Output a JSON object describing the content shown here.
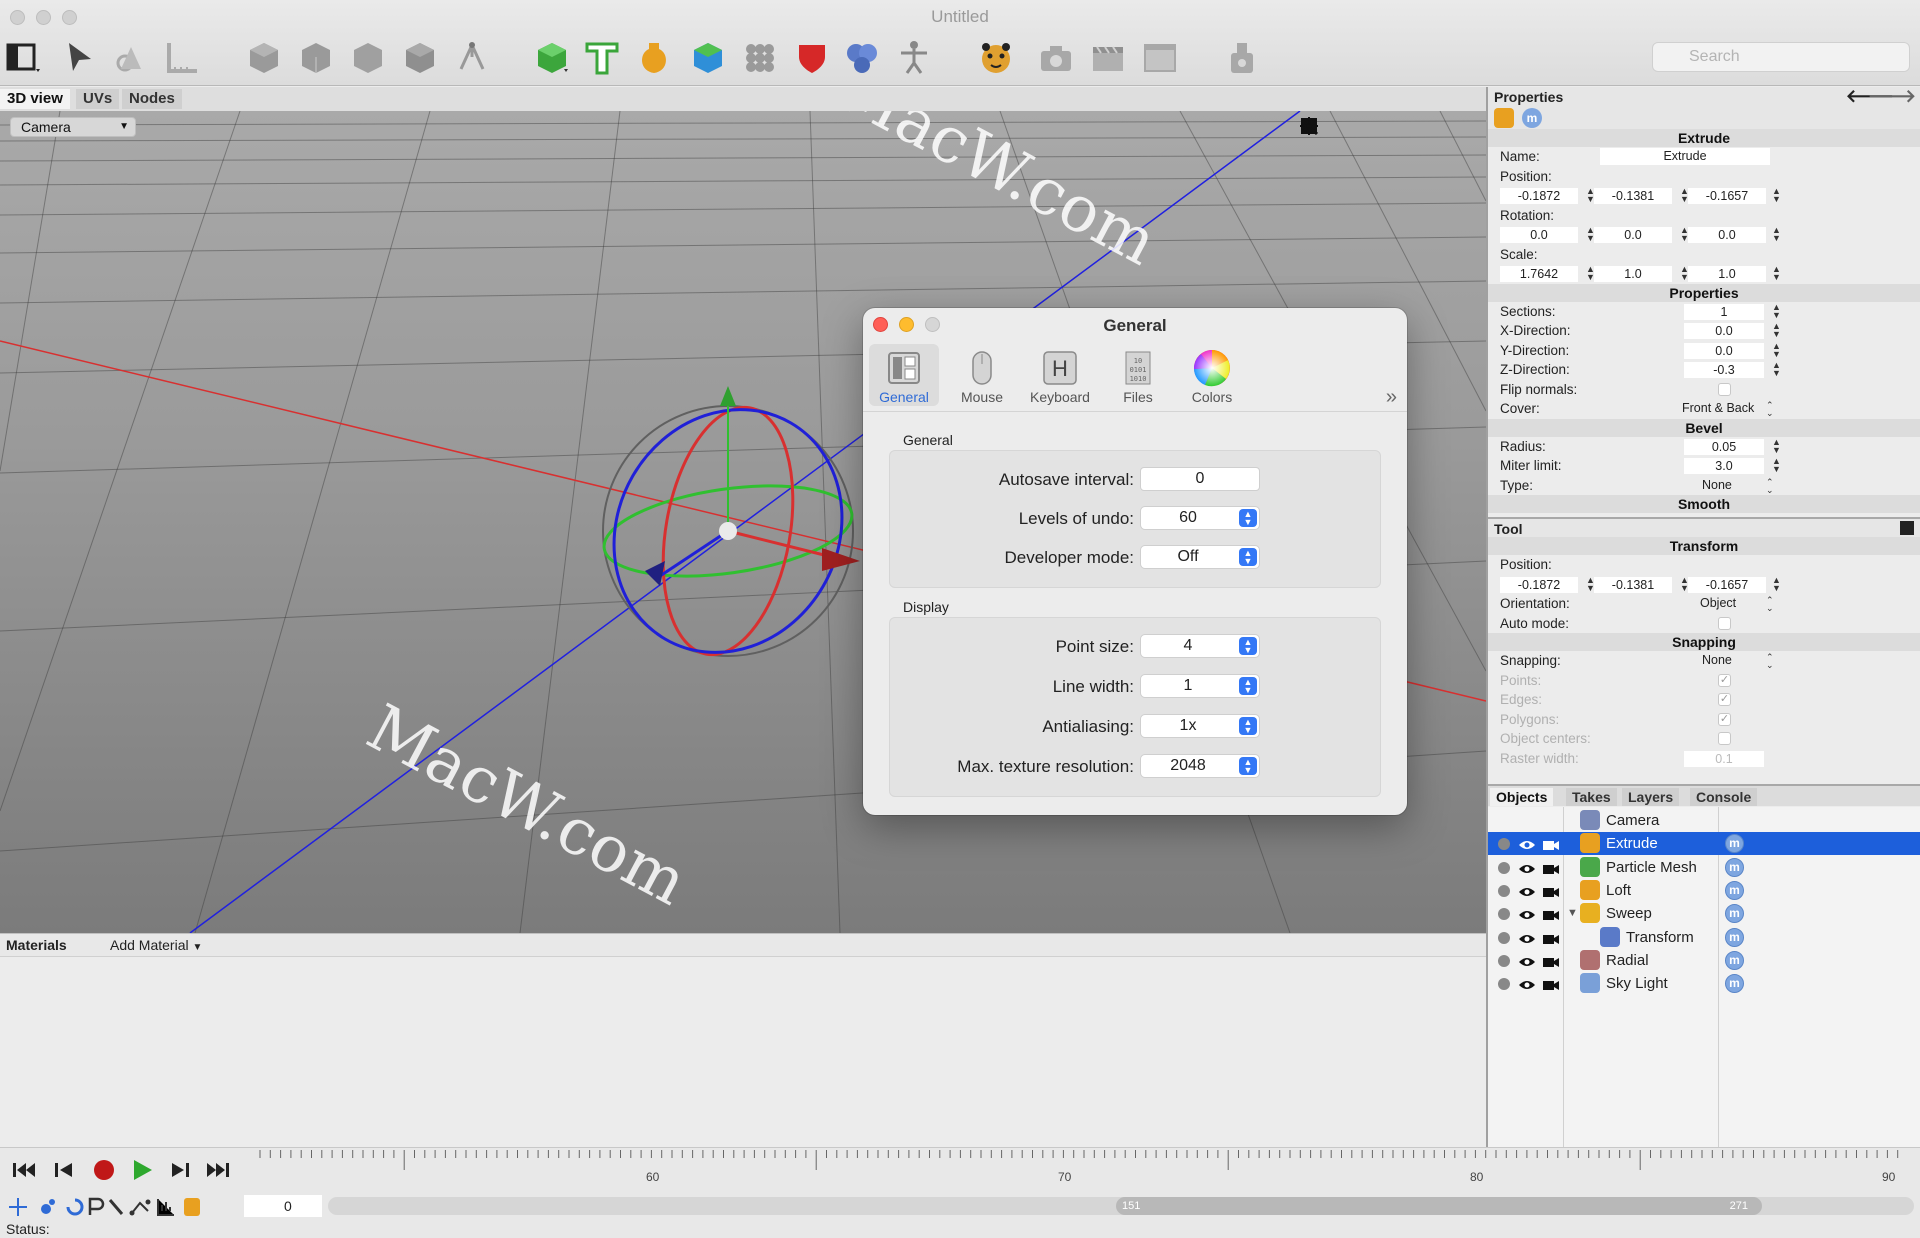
{
  "app": {
    "window_title": "Untitled",
    "search_placeholder": "Search",
    "status": "Status:"
  },
  "toolbar_icons": [
    "layout-icon",
    "select-arrow-icon",
    "transform-icon",
    "ruler-icon",
    "cube-gray-icon",
    "box-gray-icon",
    "cube2-gray-icon",
    "cube3-gray-icon",
    "vertex-icon",
    "cube-green-icon",
    "text-icon",
    "lathe-vase-icon",
    "cube-blue-icon",
    "array-icon",
    "shield-icon",
    "metaball-icon",
    "figure-icon",
    "cheetah-icon",
    "camera-icon",
    "clapper-icon",
    "window-icon",
    "export-icon"
  ],
  "view_tabs": [
    {
      "label": "3D view",
      "active": true
    },
    {
      "label": "UVs",
      "active": false
    },
    {
      "label": "Nodes",
      "active": false
    }
  ],
  "viewport": {
    "camera_select": "Camera",
    "watermark": "MacW.com"
  },
  "materials": {
    "label": "Materials",
    "add_label": "Add Material"
  },
  "properties": {
    "header": "Properties",
    "object_title": "Extrude",
    "name_label": "Name:",
    "name_value": "Extrude",
    "position_label": "Position:",
    "position": [
      "-0.1872",
      "-0.1381",
      "-0.1657"
    ],
    "rotation_label": "Rotation:",
    "rotation": [
      "0.0",
      "0.0",
      "0.0"
    ],
    "scale_label": "Scale:",
    "scale": [
      "1.7642",
      "1.0",
      "1.0"
    ],
    "properties_title": "Properties",
    "sections_label": "Sections:",
    "sections": "1",
    "xdir_label": "X-Direction:",
    "xdir": "0.0",
    "ydir_label": "Y-Direction:",
    "ydir": "0.0",
    "zdir_label": "Z-Direction:",
    "zdir": "-0.3",
    "flip_label": "Flip normals:",
    "cover_label": "Cover:",
    "cover": "Front & Back",
    "bevel_title": "Bevel",
    "radius_label": "Radius:",
    "radius": "0.05",
    "miter_label": "Miter limit:",
    "miter": "3.0",
    "type_label": "Type:",
    "type": "None",
    "smooth_title": "Smooth"
  },
  "tool": {
    "header": "Tool",
    "transform_title": "Transform",
    "position_label": "Position:",
    "position": [
      "-0.1872",
      "-0.1381",
      "-0.1657"
    ],
    "orientation_label": "Orientation:",
    "orientation": "Object",
    "auto_label": "Auto mode:",
    "snapping_title": "Snapping",
    "snapping_label": "Snapping:",
    "snapping": "None",
    "points_label": "Points:",
    "edges_label": "Edges:",
    "polygons_label": "Polygons:",
    "centers_label": "Object centers:",
    "raster_label": "Raster width:",
    "raster": "0.1"
  },
  "object_tabs": [
    {
      "label": "Objects",
      "active": true
    },
    {
      "label": "Takes",
      "active": false
    },
    {
      "label": "Layers",
      "active": false
    },
    {
      "label": "Console",
      "active": false
    }
  ],
  "objects": [
    {
      "name": "Camera",
      "icon": "camera-object-icon",
      "indent": 0,
      "selected": false,
      "controls": false
    },
    {
      "name": "Extrude",
      "icon": "extrude-icon",
      "indent": 0,
      "selected": true,
      "controls": true
    },
    {
      "name": "Particle Mesh",
      "icon": "particle-mesh-icon",
      "indent": 0,
      "selected": false,
      "controls": true
    },
    {
      "name": "Loft",
      "icon": "loft-icon",
      "indent": 0,
      "selected": false,
      "controls": true
    },
    {
      "name": "Sweep",
      "icon": "sweep-icon",
      "indent": 0,
      "selected": false,
      "controls": true
    },
    {
      "name": "Transform",
      "icon": "transform-object-icon",
      "indent": 1,
      "selected": false,
      "controls": true
    },
    {
      "name": "Radial",
      "icon": "radial-icon",
      "indent": 0,
      "selected": false,
      "controls": true
    },
    {
      "name": "Sky Light",
      "icon": "sky-light-icon",
      "indent": 0,
      "selected": false,
      "controls": true
    }
  ],
  "timeline": {
    "ticks": [
      "60",
      "70",
      "80",
      "90"
    ],
    "frame": "0",
    "range_start": "151",
    "range_end": "271"
  },
  "dialog": {
    "title": "General",
    "tabs": [
      {
        "label": "General",
        "active": true
      },
      {
        "label": "Mouse",
        "active": false
      },
      {
        "label": "Keyboard",
        "active": false
      },
      {
        "label": "Files",
        "active": false
      },
      {
        "label": "Colors",
        "active": false
      }
    ],
    "general_group": "General",
    "autosave_label": "Autosave interval:",
    "autosave": "0",
    "undo_label": "Levels of undo:",
    "undo": "60",
    "dev_label": "Developer mode:",
    "dev": "Off",
    "display_group": "Display",
    "point_label": "Point size:",
    "point": "4",
    "line_label": "Line width:",
    "line": "1",
    "aa_label": "Antialiasing:",
    "aa": "1x",
    "tex_label": "Max. texture resolution:",
    "tex": "2048"
  },
  "colors": {
    "accent": "#3478f6",
    "selection": "#1d5fdb",
    "axis_x": "#e03030",
    "axis_y": "#30c030",
    "axis_z": "#2020e0"
  }
}
